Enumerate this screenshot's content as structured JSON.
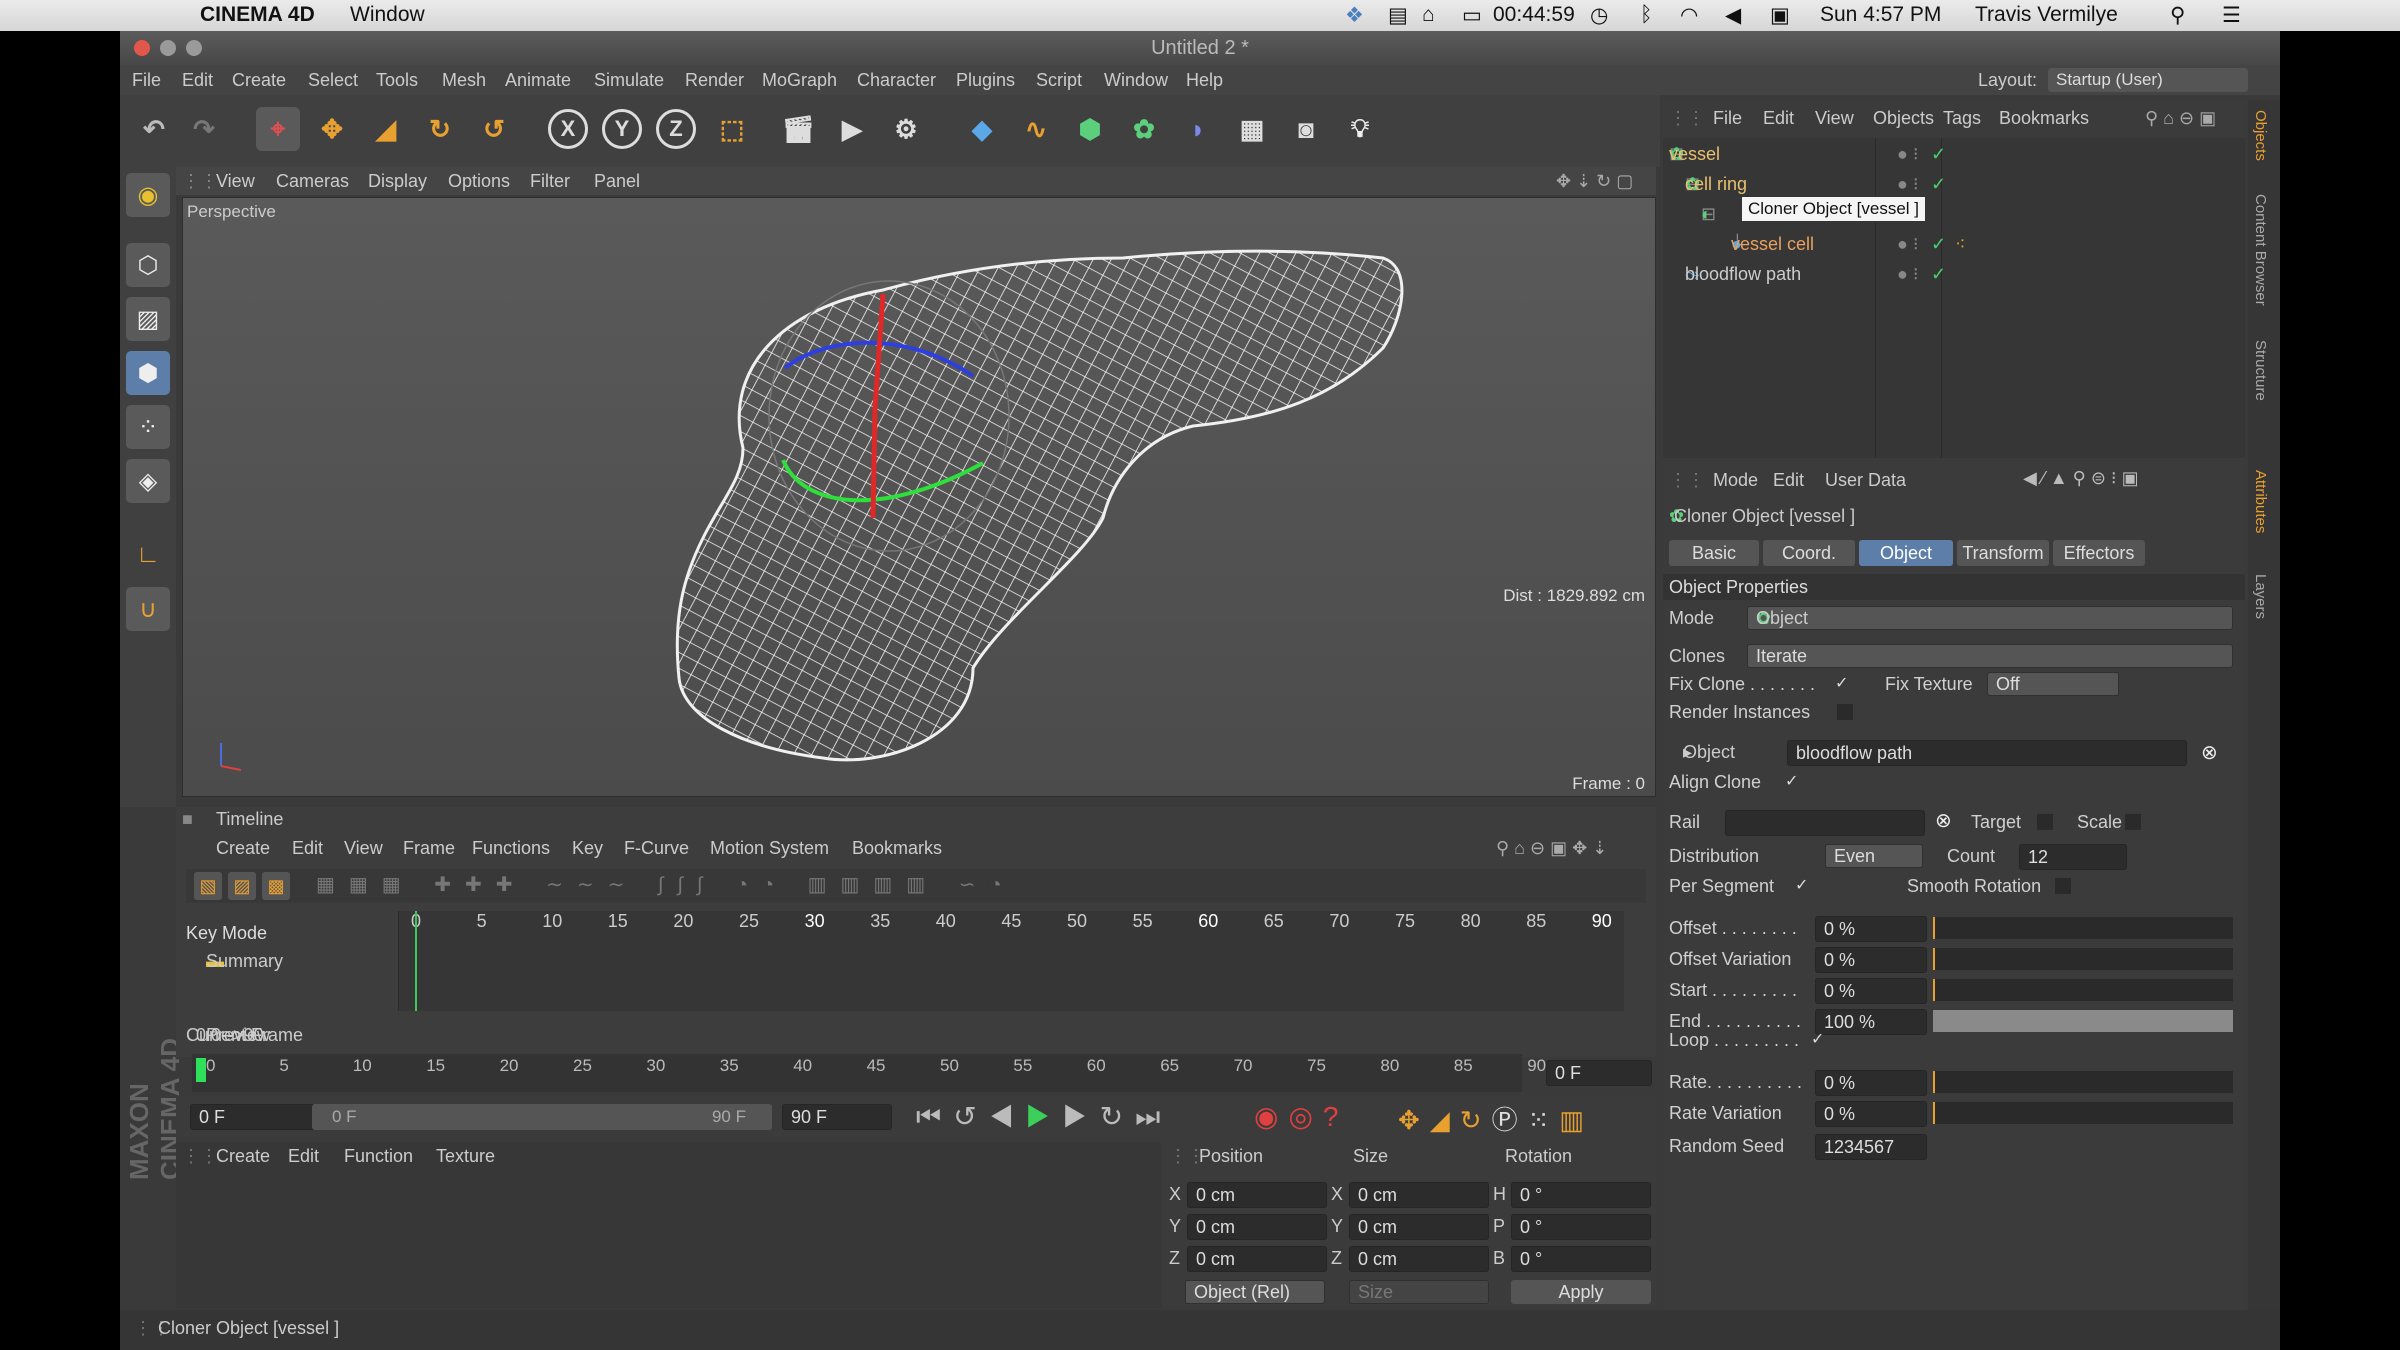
{
  "mac_menu": {
    "app": "CINEMA 4D",
    "window": "Window",
    "clock": "00:44:59",
    "datetime": "Sun 4:57 PM",
    "user": "Travis Vermilye"
  },
  "window": {
    "title": "Untitled 2 *",
    "layout_label": "Layout:",
    "layout_value": "Startup (User)"
  },
  "main_menu": [
    "File",
    "Edit",
    "Create",
    "Select",
    "Tools",
    "Mesh",
    "Animate",
    "Simulate",
    "Render",
    "MoGraph",
    "Character",
    "Plugins",
    "Script",
    "Window",
    "Help"
  ],
  "viewport": {
    "menu": [
      "View",
      "Cameras",
      "Display",
      "Options",
      "Filter",
      "Panel"
    ],
    "label": "Perspective",
    "distance": "Dist : 1829.892 cm",
    "frame": "Frame : 0"
  },
  "timeline": {
    "title": "Timeline",
    "menu": [
      "Create",
      "Edit",
      "View",
      "Frame",
      "Functions",
      "Key",
      "F-Curve",
      "Motion System",
      "Bookmarks"
    ],
    "key_mode": "Key Mode",
    "summary": "Summary",
    "ruler": [
      "0",
      "5",
      "10",
      "15",
      "20",
      "25",
      "30",
      "35",
      "40",
      "45",
      "50",
      "55",
      "60",
      "65",
      "70",
      "75",
      "80",
      "85",
      "90"
    ],
    "current_frame_label": "Current Frame",
    "current_frame": "0",
    "preview_label": "Preview",
    "preview_range": "0-->90"
  },
  "scrubber": {
    "ticks": [
      "0",
      "5",
      "10",
      "15",
      "20",
      "25",
      "30",
      "35",
      "40",
      "45",
      "50",
      "55",
      "60",
      "65",
      "70",
      "75",
      "80",
      "85",
      "90"
    ],
    "current": "0 F"
  },
  "playback": {
    "start": "0 F",
    "range_start": "0 F",
    "range_end": "90 F",
    "end": "90 F"
  },
  "material_menu": [
    "Create",
    "Edit",
    "Function",
    "Texture"
  ],
  "coords": {
    "headers": [
      "Position",
      "Size",
      "Rotation"
    ],
    "pos": [
      {
        "axis": "X",
        "value": "0 cm"
      },
      {
        "axis": "Y",
        "value": "0 cm"
      },
      {
        "axis": "Z",
        "value": "0 cm"
      }
    ],
    "size": [
      {
        "axis": "X",
        "value": "0 cm"
      },
      {
        "axis": "Y",
        "value": "0 cm"
      },
      {
        "axis": "Z",
        "value": "0 cm"
      }
    ],
    "rot": [
      {
        "axis": "H",
        "value": "0 °"
      },
      {
        "axis": "P",
        "value": "0 °"
      },
      {
        "axis": "B",
        "value": "0 °"
      }
    ],
    "mode": "Object (Rel)",
    "size_mode": "Size",
    "apply": "Apply"
  },
  "object_manager": {
    "menu": [
      "File",
      "Edit",
      "View",
      "Objects",
      "Tags",
      "Bookmarks"
    ],
    "items": [
      {
        "name": "vessel",
        "color": "#e8c070"
      },
      {
        "name": "cell ring",
        "color": "#e8c070"
      },
      {
        "name": "",
        "color": "#e8c070"
      },
      {
        "name": "vessel cell",
        "color": "#e8a060"
      },
      {
        "name": "bloodflow path",
        "color": "#cccccc"
      }
    ],
    "tooltip": "Cloner Object [vessel ]"
  },
  "attributes": {
    "menu": [
      "Mode",
      "Edit",
      "User Data"
    ],
    "object_title": "Cloner Object [vessel ]",
    "tabs": [
      "Basic",
      "Coord.",
      "Object",
      "Transform",
      "Effectors"
    ],
    "active_tab": "Object",
    "section": "Object Properties",
    "mode_label": "Mode",
    "mode_value": "Object",
    "clones_label": "Clones",
    "clones_value": "Iterate",
    "fix_clone_label": "Fix Clone . . . . . . .",
    "fix_texture_label": "Fix Texture",
    "fix_texture_value": "Off",
    "render_instances_label": "Render Instances",
    "object_label": "Object",
    "object_value": "bloodflow path",
    "align_clone_label": "Align Clone",
    "rail_label": "Rail",
    "target_label": "Target",
    "scale_label": "Scale",
    "distribution_label": "Distribution",
    "distribution_value": "Even",
    "count_label": "Count",
    "count_value": "12",
    "per_segment_label": "Per Segment",
    "smooth_rotation_label": "Smooth Rotation",
    "sliders": [
      {
        "label": "Offset . . . . . . . .",
        "value": "0 %",
        "fill": 0
      },
      {
        "label": "Offset Variation",
        "value": "0 %",
        "fill": 0
      },
      {
        "label": "Start . . . . . . . . .",
        "value": "0 %",
        "fill": 0
      },
      {
        "label": "End . . . . . . . . . .",
        "value": "100 %",
        "fill": 1
      }
    ],
    "loop_label": "Loop . . . . . . . . .",
    "rate_sliders": [
      {
        "label": "Rate. . . . . . . . . .",
        "value": "0 %",
        "fill": 0
      },
      {
        "label": "Rate Variation",
        "value": "0 %",
        "fill": 0
      }
    ],
    "seed_label": "Random Seed",
    "seed_value": "1234567"
  },
  "side_tabs": [
    "Objects",
    "Content Browser",
    "Structure",
    "Attributes",
    "Layers"
  ],
  "brand": "MAXON CINEMA 4D",
  "status": "Cloner Object [vessel ]"
}
